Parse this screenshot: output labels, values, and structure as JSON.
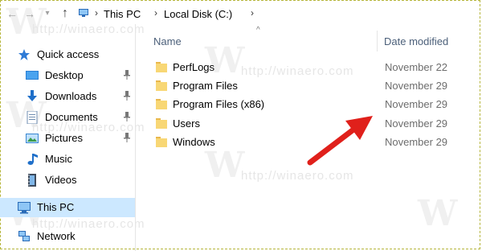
{
  "address_bar": {
    "back_icon": "arrow-left-icon",
    "forward_icon": "arrow-right-icon",
    "recent_icon": "chevron-down-icon",
    "up_icon": "arrow-up-icon",
    "crumbs": [
      "This PC",
      "Local Disk (C:)"
    ],
    "separator": "›"
  },
  "nav_pane": {
    "items": [
      {
        "label": "Quick access",
        "icon": "star-icon",
        "pinned": false,
        "top": true
      },
      {
        "label": "Desktop",
        "icon": "desktop-icon",
        "pinned": true
      },
      {
        "label": "Downloads",
        "icon": "download-arrow-icon",
        "pinned": true
      },
      {
        "label": "Documents",
        "icon": "document-icon",
        "pinned": true
      },
      {
        "label": "Pictures",
        "icon": "pictures-icon",
        "pinned": true
      },
      {
        "label": "Music",
        "icon": "music-note-icon",
        "pinned": false
      },
      {
        "label": "Videos",
        "icon": "film-icon",
        "pinned": false
      },
      {
        "label": "This PC",
        "icon": "computer-icon",
        "pinned": false,
        "top": true,
        "selected": true
      },
      {
        "label": "Network",
        "icon": "network-icon",
        "pinned": false,
        "top": true
      }
    ]
  },
  "file_list": {
    "columns": {
      "name": "Name",
      "date_modified": "Date modified"
    },
    "rows": [
      {
        "name": "PerfLogs",
        "date": "November 22"
      },
      {
        "name": "Program Files",
        "date": "November 29"
      },
      {
        "name": "Program Files (x86)",
        "date": "November 29"
      },
      {
        "name": "Users",
        "date": "November 29"
      },
      {
        "name": "Windows",
        "date": "November 29"
      }
    ]
  },
  "watermark": {
    "text": "http://winaero.com",
    "logo_letter": "W"
  },
  "colors": {
    "selection": "#cce8ff",
    "folder": "#f8d775",
    "arrow": "#e0201b",
    "header_text": "#4c607a",
    "date_text": "#6d6d6d"
  }
}
